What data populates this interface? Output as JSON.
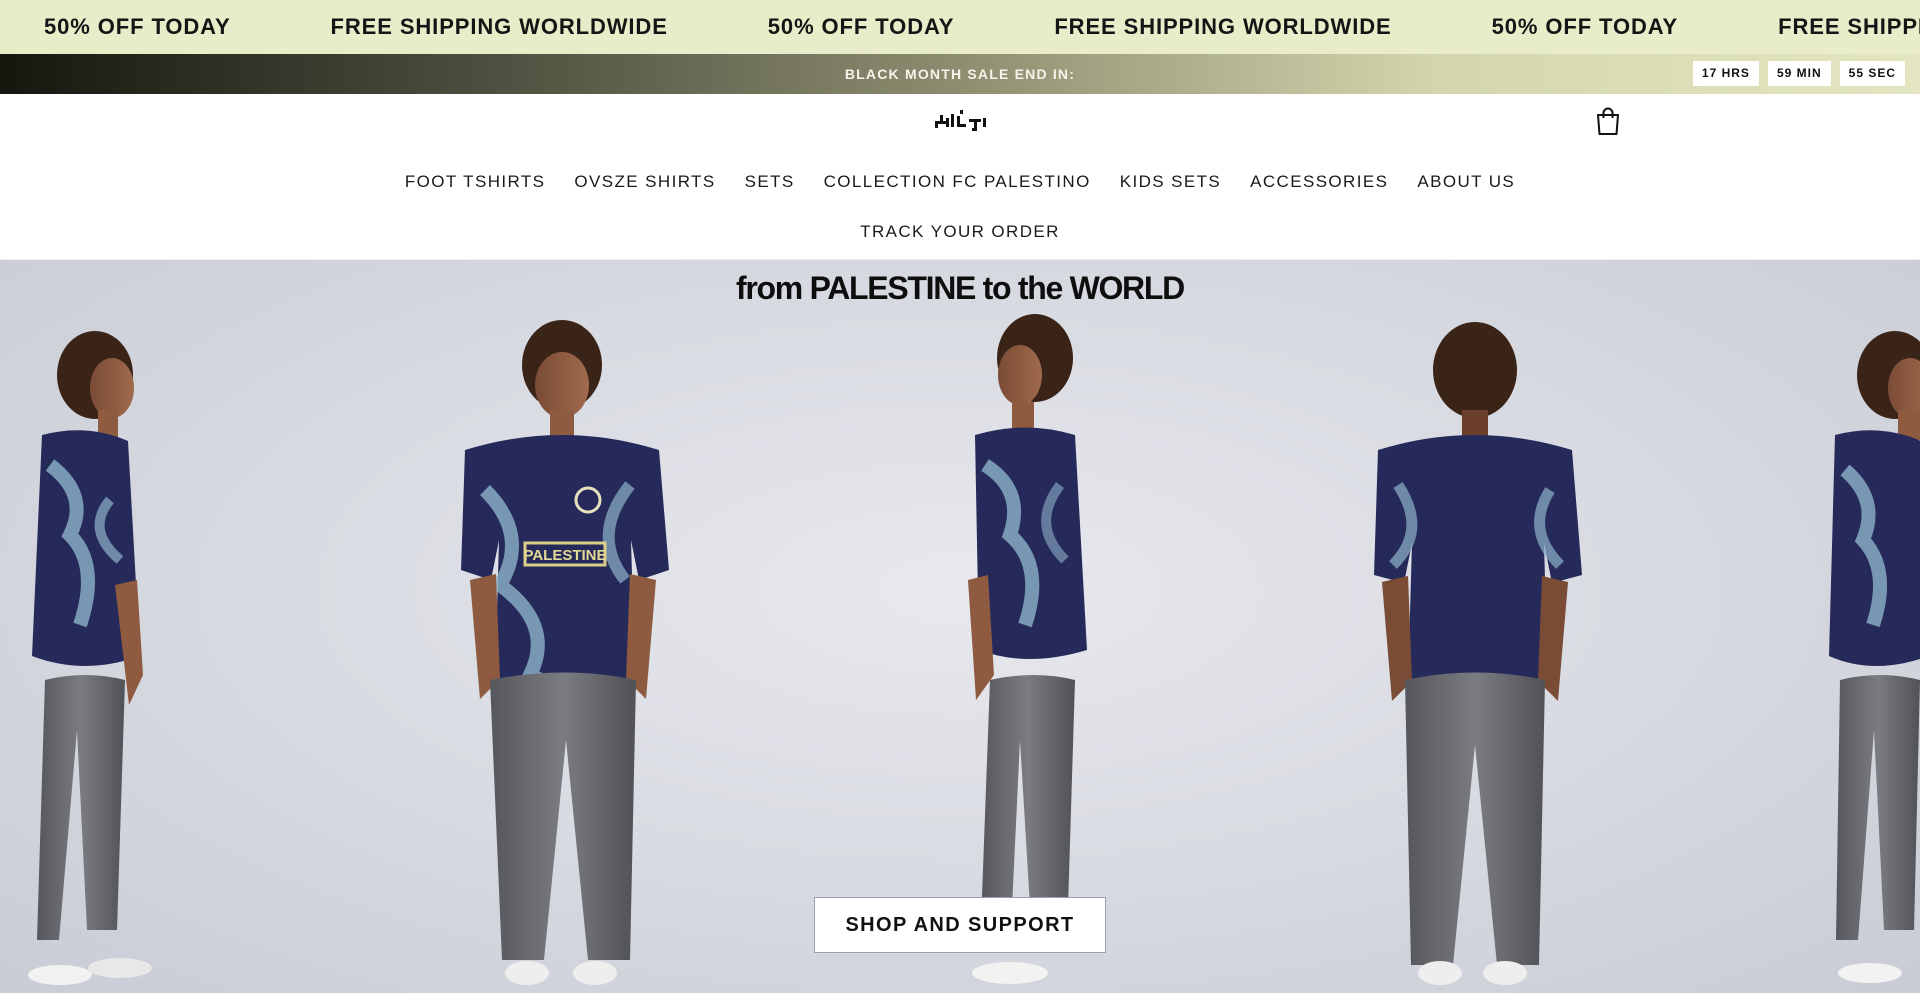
{
  "marquee": {
    "items": [
      "50% OFF TODAY",
      "FREE SHIPPING WORLDWIDE",
      "50% OFF TODAY",
      "FREE SHIPPING WORLDWIDE",
      "50% OFF TODAY",
      "FREE SHIPPING WORLDWIDE"
    ]
  },
  "countdown": {
    "label": "BLACK MONTH SALE END IN:",
    "hours": "17 HRS",
    "minutes": "59 MIN",
    "seconds": "55 SEC"
  },
  "header": {
    "logo_icon": "brand-logo",
    "cart_icon": "shopping-bag-icon"
  },
  "nav": {
    "row1": [
      "FOOT TSHIRTS",
      "OVSZE SHIRTS",
      "SETS",
      "COLLECTION FC PALESTINO",
      "KIDS SETS",
      "ACCESSORIES",
      "ABOUT US"
    ],
    "row2": [
      "TRACK YOUR ORDER"
    ]
  },
  "hero": {
    "headline": {
      "part1": "from ",
      "part2": "PALESTINE",
      "part3": " to the ",
      "part4": "WORLD"
    },
    "jersey_text": "PALESTINE",
    "cta_label": "SHOP AND SUPPORT"
  },
  "colors": {
    "marquee_bg": "#e8ecc9",
    "jersey_navy": "#262a5a",
    "jersey_swirl": "#8db3c9",
    "pants_grey": "#6a6c70"
  }
}
